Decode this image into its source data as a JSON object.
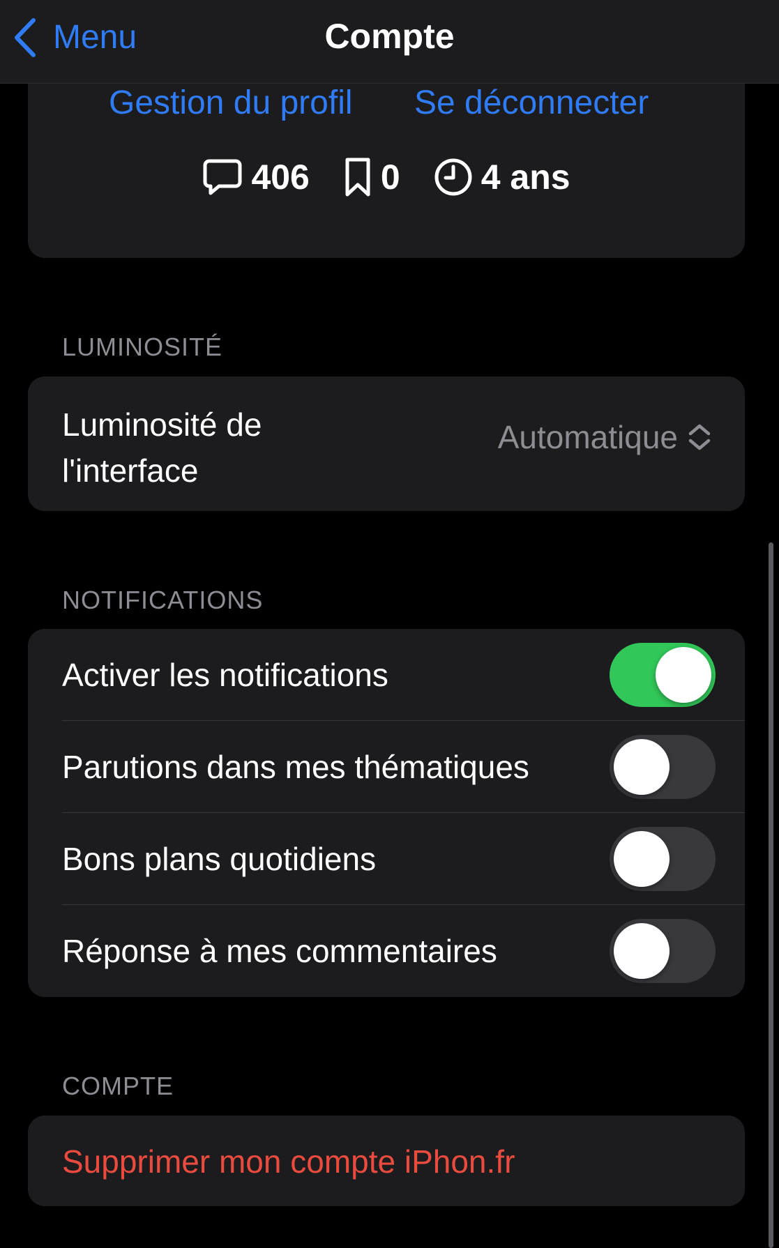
{
  "nav": {
    "back_label": "Menu",
    "title": "Compte"
  },
  "profile": {
    "manage_label": "Gestion du profil",
    "logout_label": "Se déconnecter",
    "stats": {
      "comments": "406",
      "bookmarks": "0",
      "member_since": "4 ans"
    }
  },
  "brightness": {
    "header": "LUMINOSITÉ",
    "label": "Luminosité de l'interface",
    "value": "Automatique"
  },
  "notifications": {
    "header": "NOTIFICATIONS",
    "items": [
      {
        "label": "Activer les notifications",
        "on": true
      },
      {
        "label": "Parutions dans mes thématiques",
        "on": false
      },
      {
        "label": "Bons plans quotidiens",
        "on": false
      },
      {
        "label": "Réponse à mes commentaires",
        "on": false
      }
    ]
  },
  "account": {
    "header": "COMPTE",
    "delete_label": "Supprimer mon compte iPhon.fr"
  },
  "colors": {
    "accent_blue": "#2f7cf6",
    "toggle_on": "#31c759",
    "destructive_red": "#ea4b3f",
    "card_bg": "#1c1c1e",
    "secondary_text": "#8d8d93"
  },
  "icons": {
    "back": "chevron-left-icon",
    "comments": "speech-bubble-icon",
    "bookmarks": "bookmark-icon",
    "member_since": "clock-icon",
    "picker": "chevron-up-down-icon"
  }
}
